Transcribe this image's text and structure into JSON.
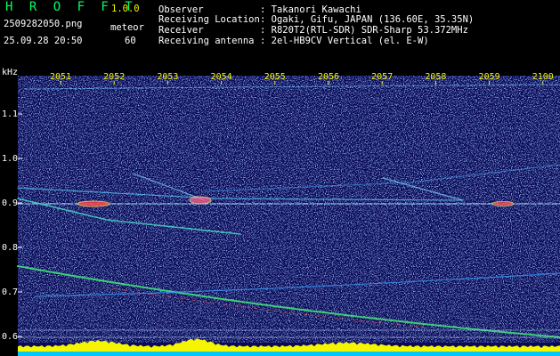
{
  "header": {
    "brand": "H R O F F T",
    "version": "1.0.0",
    "filename": "2509282050.png",
    "datetime": "25.09.28 20:50",
    "meteor_label": "meteor",
    "meteor_count": "60"
  },
  "info": [
    {
      "label": "Observer",
      "value": ": Takanori Kawachi"
    },
    {
      "label": "Receiving Location",
      "value": ": Ogaki, Gifu, JAPAN (136.60E, 35.35N)"
    },
    {
      "label": "Receiver",
      "value": ": R820T2(RTL-SDR) SDR-Sharp 53.372MHz"
    },
    {
      "label": "Receiving antenna",
      "value": ": 2el-HB9CV Vertical (el. E-W)"
    }
  ],
  "axes": {
    "freq_unit": "kHz",
    "time_ticks": [
      "2051",
      "2052",
      "2053",
      "2054",
      "2055",
      "2056",
      "2057",
      "2058",
      "2059",
      "2100"
    ],
    "freq_ticks": [
      "1.1",
      "1.0",
      "0.9",
      "0.8",
      "0.7",
      "0.6"
    ]
  },
  "colors": {
    "background": "#0a0a55",
    "text_yellow": "#f5f500",
    "brand_green": "#00ff66",
    "baseline_yellow": "#f5f500",
    "baseline_cyan": "#00c8ff"
  }
}
